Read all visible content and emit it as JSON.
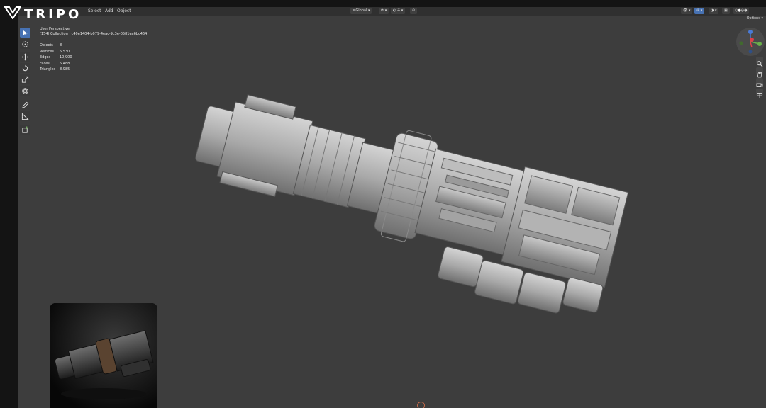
{
  "brand": {
    "logo_text": "TRIPO"
  },
  "menu": {
    "items": [
      "Select",
      "Add",
      "Object"
    ]
  },
  "header": {
    "orientation_label": "Global",
    "options_label": "Options"
  },
  "viewport_info": {
    "perspective": "User Perspective",
    "collection": "(154) Collection | c40e1404-b079-4eac-9c3e-0581ea6bc464"
  },
  "stats": [
    {
      "label": "Objects",
      "value": "8"
    },
    {
      "label": "Vertices",
      "value": "5,530"
    },
    {
      "label": "Edges",
      "value": "10,900"
    },
    {
      "label": "Faces",
      "value": "5,488"
    },
    {
      "label": "Triangles",
      "value": "8,985"
    }
  ],
  "tools": [
    {
      "name": "select-tool",
      "icon": "cursor-arrow-icon",
      "active": true
    },
    {
      "name": "cursor-tool",
      "icon": "cursor-target-icon",
      "active": false
    },
    {
      "name": "move-tool",
      "icon": "move-arrows-icon",
      "active": false
    },
    {
      "name": "rotate-tool",
      "icon": "rotate-icon",
      "active": false
    },
    {
      "name": "scale-tool",
      "icon": "scale-icon",
      "active": false
    },
    {
      "name": "transform-tool",
      "icon": "transform-icon",
      "active": false
    },
    {
      "name": "annotate-tool",
      "icon": "pencil-icon",
      "active": false
    },
    {
      "name": "measure-tool",
      "icon": "ruler-icon",
      "active": false
    },
    {
      "name": "add-cube-tool",
      "icon": "cube-add-icon",
      "active": false
    }
  ],
  "navigation": [
    {
      "name": "zoom-icon"
    },
    {
      "name": "hand-pan-icon"
    },
    {
      "name": "camera-icon"
    },
    {
      "name": "perspective-grid-icon"
    }
  ],
  "colors": {
    "viewport_bg": "#3d3d3d",
    "accent_blue": "#4772b3",
    "axis_x": "#e0404a",
    "axis_y": "#6ab04a",
    "axis_z": "#4a7bd8"
  }
}
